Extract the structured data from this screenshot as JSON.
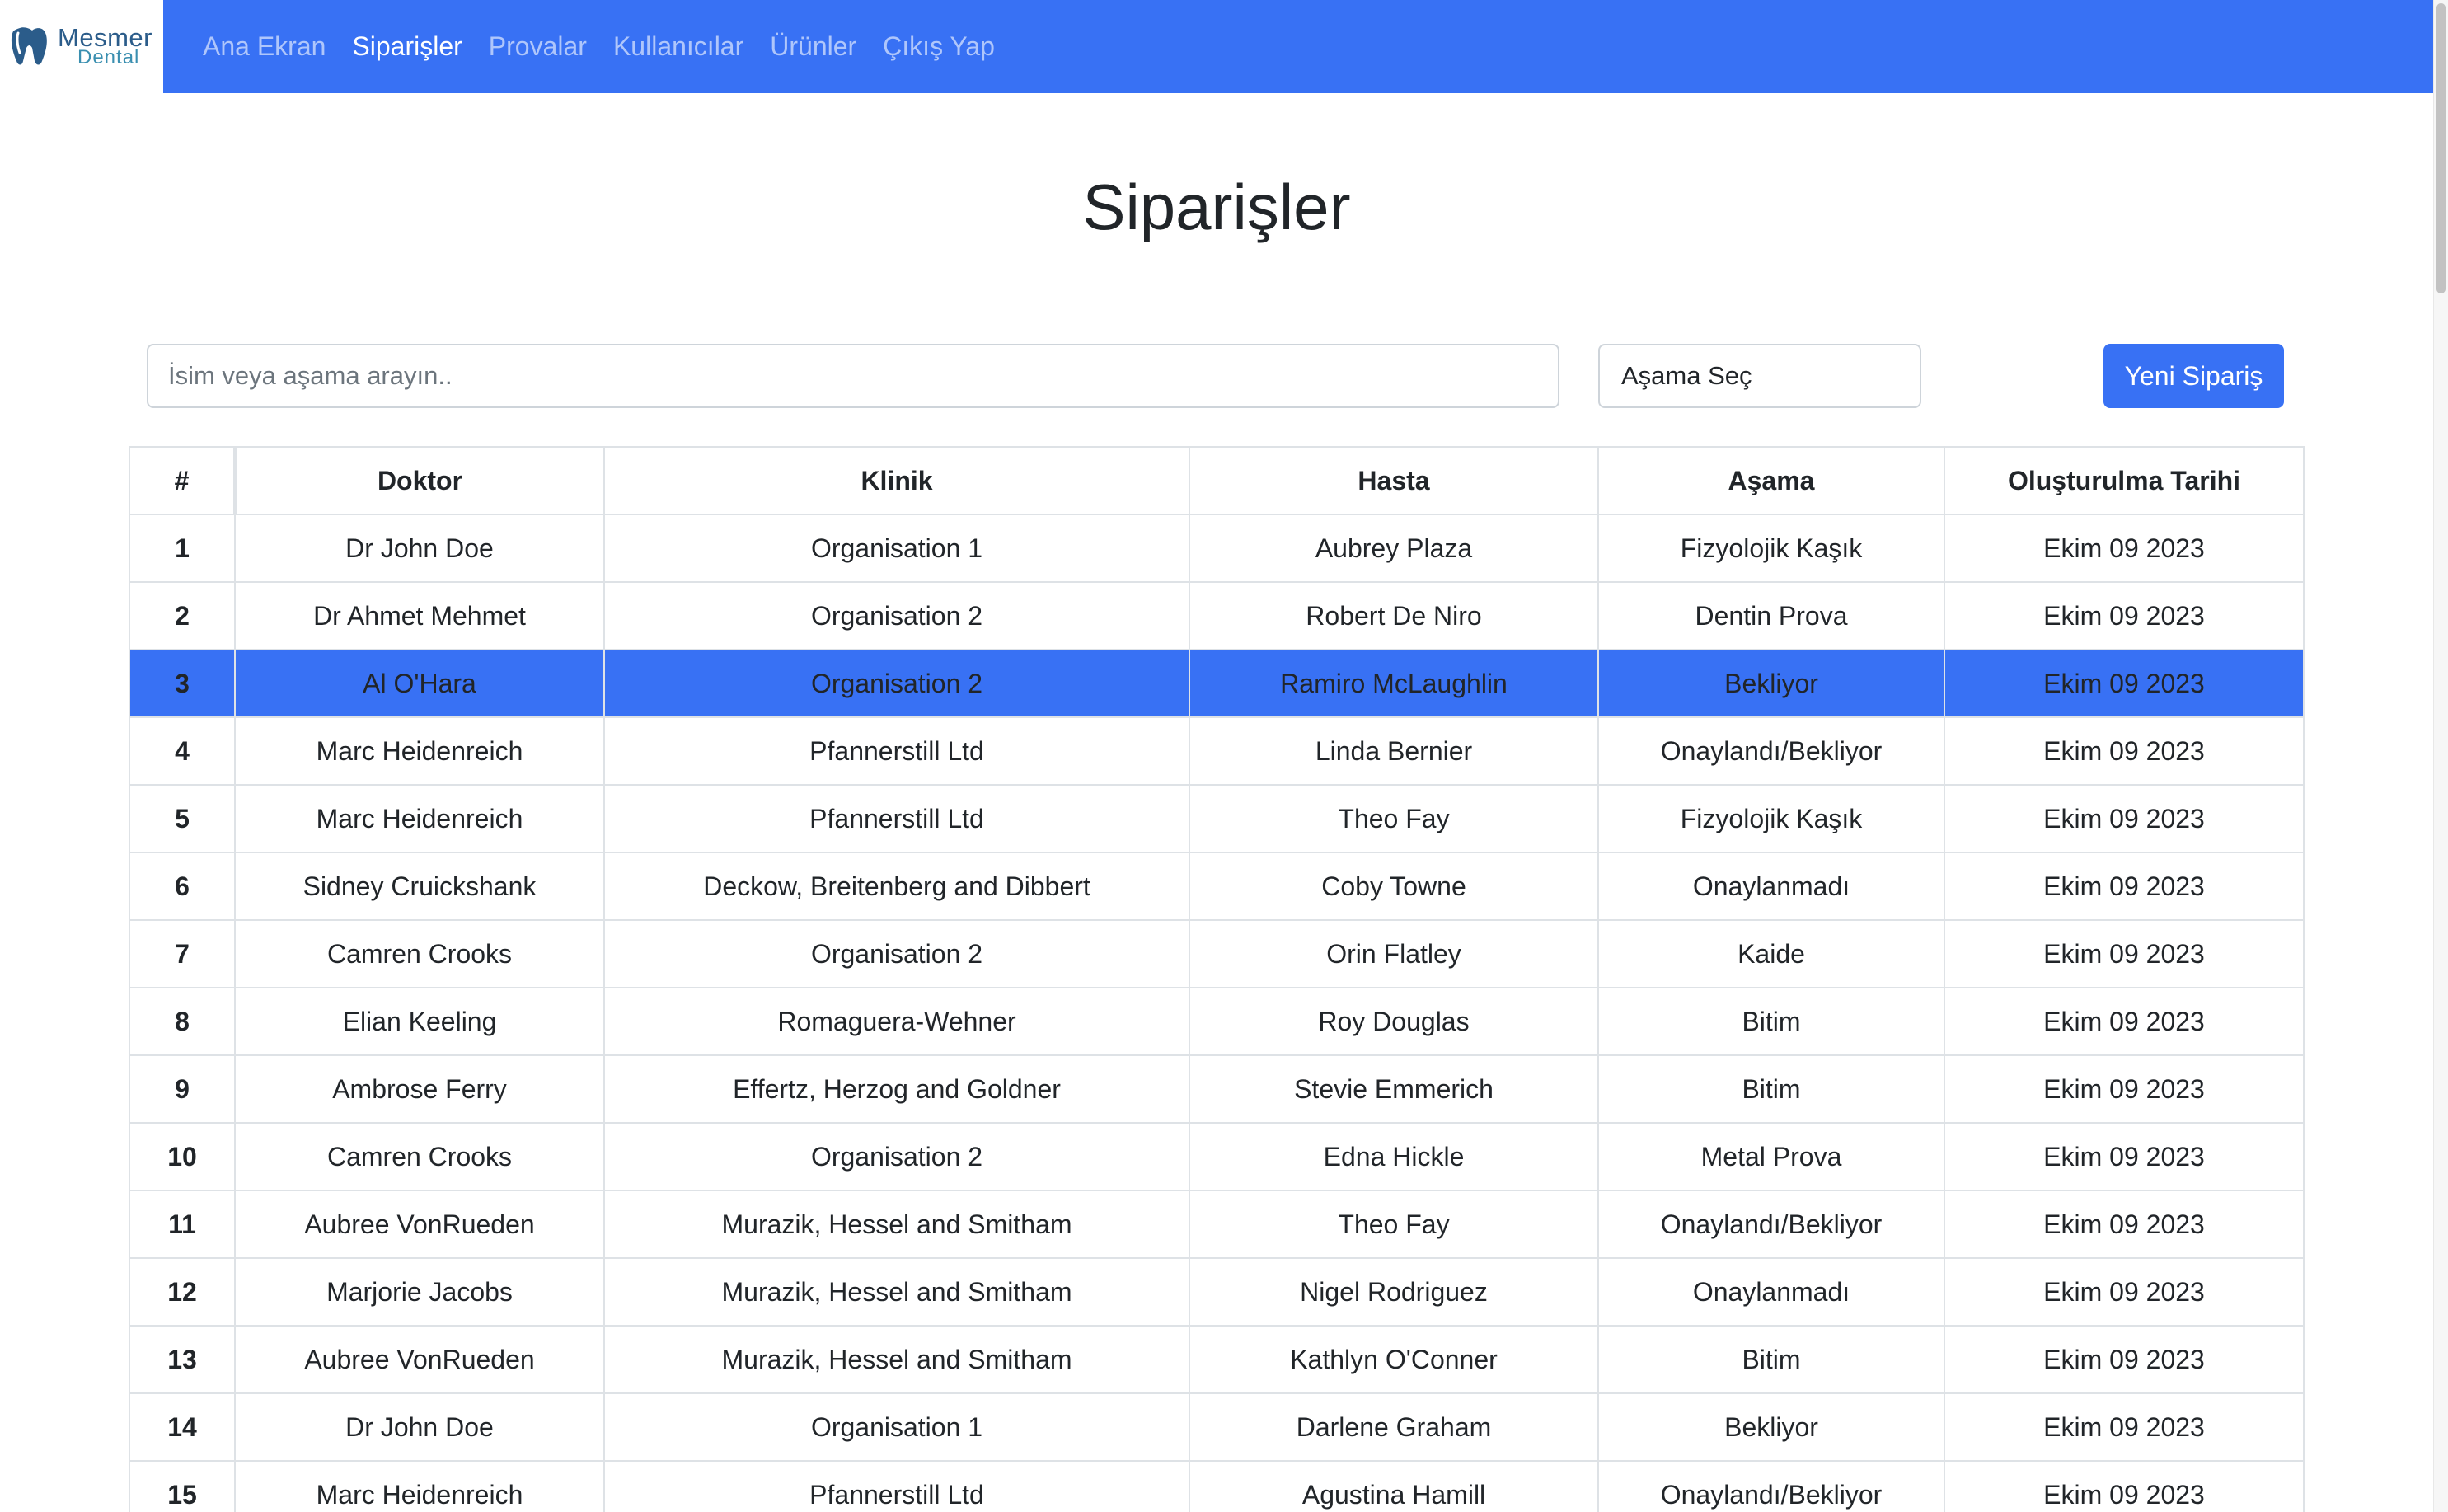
{
  "brand": {
    "name_top": "Mesmer",
    "name_bottom": "Dental",
    "primary_color": "#3871f4"
  },
  "nav": {
    "items": [
      {
        "label": "Ana Ekran",
        "active": false
      },
      {
        "label": "Siparişler",
        "active": true
      },
      {
        "label": "Provalar",
        "active": false
      },
      {
        "label": "Kullanıcılar",
        "active": false
      },
      {
        "label": "Ürünler",
        "active": false
      },
      {
        "label": "Çıkış Yap",
        "active": false
      }
    ]
  },
  "page": {
    "title": "Siparişler"
  },
  "controls": {
    "search_placeholder": "İsim veya aşama arayın..",
    "search_value": "",
    "stage_select_value": "Aşama Seç",
    "new_order_label": "Yeni Sipariş"
  },
  "table": {
    "headers": [
      "#",
      "Doktor",
      "Klinik",
      "Hasta",
      "Aşama",
      "Oluşturulma Tarihi"
    ],
    "selected_row": 3,
    "rows": [
      [
        "1",
        "Dr John Doe",
        "Organisation 1",
        "Aubrey Plaza",
        "Fizyolojik Kaşık",
        "Ekim 09 2023"
      ],
      [
        "2",
        "Dr Ahmet Mehmet",
        "Organisation 2",
        "Robert De Niro",
        "Dentin Prova",
        "Ekim 09 2023"
      ],
      [
        "3",
        "Al O'Hara",
        "Organisation 2",
        "Ramiro McLaughlin",
        "Bekliyor",
        "Ekim 09 2023"
      ],
      [
        "4",
        "Marc Heidenreich",
        "Pfannerstill Ltd",
        "Linda Bernier",
        "Onaylandı/Bekliyor",
        "Ekim 09 2023"
      ],
      [
        "5",
        "Marc Heidenreich",
        "Pfannerstill Ltd",
        "Theo Fay",
        "Fizyolojik Kaşık",
        "Ekim 09 2023"
      ],
      [
        "6",
        "Sidney Cruickshank",
        "Deckow, Breitenberg and Dibbert",
        "Coby Towne",
        "Onaylanmadı",
        "Ekim 09 2023"
      ],
      [
        "7",
        "Camren Crooks",
        "Organisation 2",
        "Orin Flatley",
        "Kaide",
        "Ekim 09 2023"
      ],
      [
        "8",
        "Elian Keeling",
        "Romaguera-Wehner",
        "Roy Douglas",
        "Bitim",
        "Ekim 09 2023"
      ],
      [
        "9",
        "Ambrose Ferry",
        "Effertz, Herzog and Goldner",
        "Stevie Emmerich",
        "Bitim",
        "Ekim 09 2023"
      ],
      [
        "10",
        "Camren Crooks",
        "Organisation 2",
        "Edna Hickle",
        "Metal Prova",
        "Ekim 09 2023"
      ],
      [
        "11",
        "Aubree VonRueden",
        "Murazik, Hessel and Smitham",
        "Theo Fay",
        "Onaylandı/Bekliyor",
        "Ekim 09 2023"
      ],
      [
        "12",
        "Marjorie Jacobs",
        "Murazik, Hessel and Smitham",
        "Nigel Rodriguez",
        "Onaylanmadı",
        "Ekim 09 2023"
      ],
      [
        "13",
        "Aubree VonRueden",
        "Murazik, Hessel and Smitham",
        "Kathlyn O'Conner",
        "Bitim",
        "Ekim 09 2023"
      ],
      [
        "14",
        "Dr John Doe",
        "Organisation 1",
        "Darlene Graham",
        "Bekliyor",
        "Ekim 09 2023"
      ],
      [
        "15",
        "Marc Heidenreich",
        "Pfannerstill Ltd",
        "Agustina Hamill",
        "Onaylandı/Bekliyor",
        "Ekim 09 2023"
      ]
    ]
  },
  "icons": {
    "logo": "tooth-logo-icon"
  }
}
